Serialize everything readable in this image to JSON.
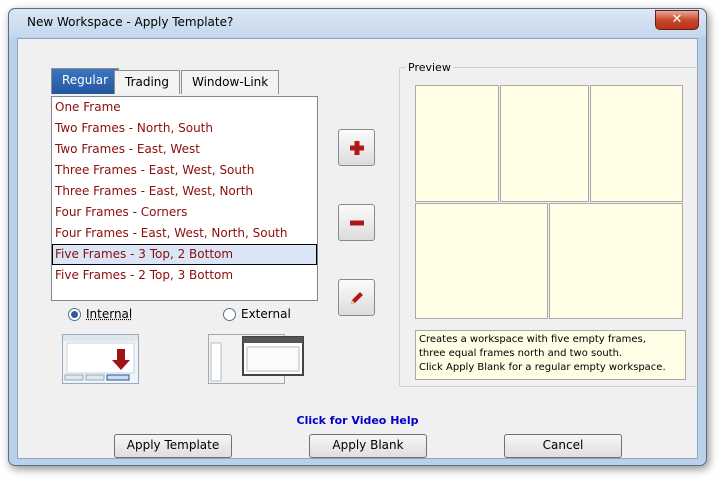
{
  "window": {
    "title": "New Workspace - Apply Template?",
    "close_label": "✕"
  },
  "tabs": [
    {
      "label": "Regular"
    },
    {
      "label": "Trading"
    },
    {
      "label": "Window-Link"
    }
  ],
  "templates": [
    "One Frame",
    "Two Frames - North, South",
    "Two Frames - East, West",
    "Three Frames - East, West, South",
    "Three Frames - East, West, North",
    "Four Frames - Corners",
    "Four Frames - East, West, North, South",
    "Five Frames - 3 Top, 2 Bottom",
    "Five Frames - 2 Top, 3 Bottom"
  ],
  "selected_template": "Five Frames - 3 Top, 2 Bottom",
  "side_buttons": {
    "add_icon": "plus-icon",
    "remove_icon": "minus-icon",
    "edit_icon": "pencil-icon"
  },
  "location": {
    "internal_label": "Internal",
    "external_label": "External",
    "selected": "Internal"
  },
  "preview": {
    "label": "Preview",
    "description_line1": "Creates a workspace with five empty frames,",
    "description_line2": "three equal frames north and two south.",
    "description_line3": "Click Apply Blank for a regular empty workspace."
  },
  "help_link": "Click for Video Help",
  "buttons": {
    "apply_template": "Apply Template",
    "apply_blank": "Apply Blank",
    "cancel": "Cancel"
  },
  "colors": {
    "accent": "#2456a0",
    "list_text": "#8b0d0d",
    "preview_fill": "#fffde6",
    "action_icon": "#b01818"
  }
}
